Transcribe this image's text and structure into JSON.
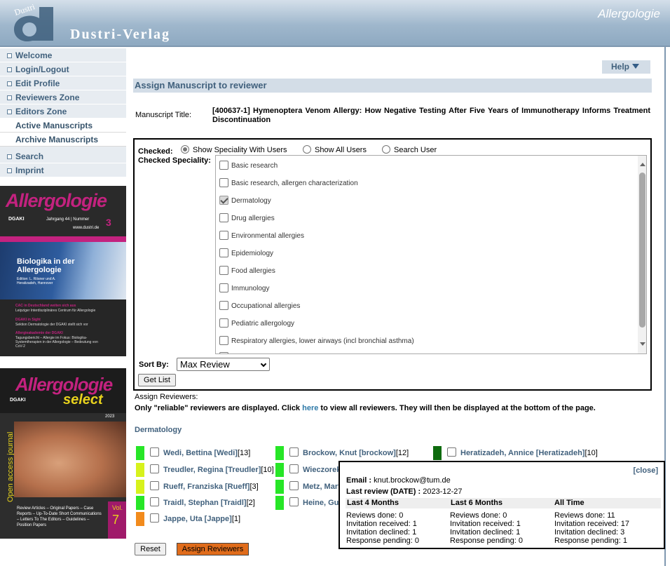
{
  "header": {
    "logo_text": "Dustri",
    "brand": "Dustri-Verlag",
    "journal": "Allergologie"
  },
  "nav": [
    {
      "label": "Welcome",
      "sub": false
    },
    {
      "label": "Login/Logout",
      "sub": false
    },
    {
      "label": "Edit Profile",
      "sub": false
    },
    {
      "label": "Reviewers Zone",
      "sub": false
    },
    {
      "label": "Editors Zone",
      "sub": false
    },
    {
      "label": "Active Manuscripts",
      "sub": true
    },
    {
      "label": "Archive Manuscripts",
      "sub": true
    },
    {
      "label": "Search",
      "sub": false
    },
    {
      "label": "Imprint",
      "sub": false
    }
  ],
  "cover1": {
    "title": "Allergologie",
    "jahrgang": "Jahrgang 44 | Nummer",
    "issue": "3",
    "site": "www.dustri.de",
    "org": "DGAKI",
    "headline": "Biologika in der Allergologie",
    "edition": "Edition: L. Rösner und A. Heratizadeh, Hannover",
    "bullets": [
      "CAC in Deutschland weiten sich aus",
      "Leipziger Interdisziplinäres Centrum für Allergologie",
      "DGAKI in Sight",
      "Sektion Dermatologie der DGAKI stellt sich vor",
      "Allergieakademie der DGAKI",
      "Tagungsbericht – Allergie im Fokus: Biologika-Systemtherapien in der Allergologie – Bedeutung von CoV-2"
    ]
  },
  "cover2": {
    "title": "Allergologie",
    "subtitle": "select",
    "org": "DGAKI",
    "side": "Open access journal",
    "vol": "Vol.",
    "volnum": "7",
    "year": "2023",
    "footer": "Review Articles – Original Papers – Case Reports – Up-To-Date Short Communications – Letters To The Editors – Guidelines – Position Papers"
  },
  "main": {
    "help": "Help",
    "page_title": "Assign Manuscript to reviewer",
    "manuscript_label": "Manuscript Title:",
    "manuscript_title": "[400637-1] Hymenoptera Venom Allergy: How Negative Testing After Five Years of Immunotherapy Informs Treatment Discontinuation",
    "checked_label": "Checked:",
    "radios": [
      {
        "label": "Show Speciality With Users",
        "checked": true
      },
      {
        "label": "Show All Users",
        "checked": false
      },
      {
        "label": "Search User",
        "checked": false
      }
    ],
    "speciality_label": "Checked Speciality:",
    "specialities": [
      {
        "label": "Basic research",
        "checked": false
      },
      {
        "label": "Basic research, allergen characterization",
        "checked": false
      },
      {
        "label": "Dermatology",
        "checked": true
      },
      {
        "label": "Drug allergies",
        "checked": false
      },
      {
        "label": "Environmental allergies",
        "checked": false
      },
      {
        "label": "Epidemiology",
        "checked": false
      },
      {
        "label": "Food allergies",
        "checked": false
      },
      {
        "label": "Immunology",
        "checked": false
      },
      {
        "label": "Occupational allergies",
        "checked": false
      },
      {
        "label": "Pediatric allergology",
        "checked": false
      },
      {
        "label": "Respiratory allergies, lower airways (incl bronchial asthma)",
        "checked": false
      }
    ],
    "sort_label": "Sort By:",
    "sort_value": "Max Review",
    "get_list": "Get List",
    "assign_reviewers_label": "Assign Reviewers:",
    "reliable_note_pre": "Only \"reliable\" reviewers are displayed. Click ",
    "reliable_link": "here",
    "reliable_note_post": " to view all reviewers. They will then be displayed at the bottom of the page.",
    "section": "Dermatology",
    "reviewers": [
      {
        "name": "Wedi, Bettina [Wedi]",
        "count": "[13]",
        "color": "#27e627"
      },
      {
        "name": "Treudler, Regina [Treudler]",
        "count": "[10]",
        "color": "#d7f21c"
      },
      {
        "name": "Rueff, Franziska [Rueff]",
        "count": "[3]",
        "color": "#d7f21c"
      },
      {
        "name": "Traidl, Stephan [Traidl]",
        "count": "[2]",
        "color": "#27e627"
      },
      {
        "name": "Jappe, Uta [Jappe]",
        "count": "[1]",
        "color": "#f28b1c"
      },
      {
        "name": "Brockow, Knut [brockow]",
        "count": "[12]",
        "color": "#27e627"
      },
      {
        "name": "Wieczorek",
        "count": "",
        "color": "#27e627"
      },
      {
        "name": "Metz, Mart",
        "count": "",
        "color": "#27e627"
      },
      {
        "name": "Heine, Gu",
        "count": "",
        "color": "#27e627"
      },
      {
        "name": "Heratizadeh, Annice [Heratizadeh]",
        "count": "[10]",
        "color": "#0e6b0e"
      }
    ],
    "reset": "Reset",
    "assign": "Assign Reviewers"
  },
  "popup": {
    "close": "[close]",
    "email_label": "Email :",
    "email": "knut.brockow@tum.de",
    "last_review_label": "Last review (DATE) :",
    "last_review": "2023-12-27",
    "columns": [
      {
        "title": "Last 4 Months",
        "reviews_done": "Reviews done: 0",
        "inv_received": "Invitation received: 1",
        "inv_declined": "Invitation declined: 1",
        "pending": "Response pending: 0"
      },
      {
        "title": "Last 6 Months",
        "reviews_done": "Reviews done: 0",
        "inv_received": "Invitation received: 1",
        "inv_declined": "Invitation declined: 1",
        "pending": "Response pending: 0"
      },
      {
        "title": "All Time",
        "reviews_done": "Reviews done: 11",
        "inv_received": "Invitation received: 17",
        "inv_declined": "Invitation declined: 3",
        "pending": "Response pending: 1"
      }
    ]
  }
}
